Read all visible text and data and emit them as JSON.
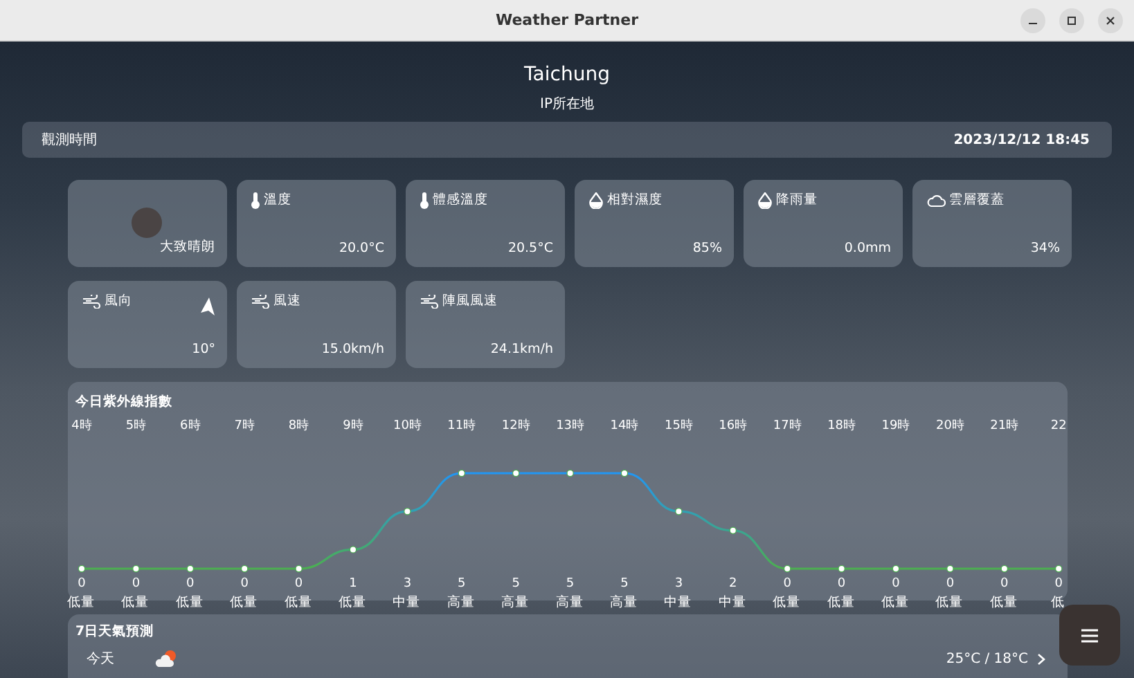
{
  "window": {
    "title": "Weather Partner"
  },
  "location": {
    "city": "Taichung",
    "source": "IP所在地"
  },
  "observation": {
    "label": "觀測時間",
    "time": "2023/12/12 18:45"
  },
  "cards": [
    {
      "kind": "condition",
      "value": "大致晴朗"
    },
    {
      "kind": "thermometer",
      "label": "溫度",
      "value": "20.0°C"
    },
    {
      "kind": "thermometer",
      "label": "體感溫度",
      "value": "20.5°C"
    },
    {
      "kind": "drop",
      "label": "相對濕度",
      "value": "85%"
    },
    {
      "kind": "drop",
      "label": "降雨量",
      "value": "0.0mm"
    },
    {
      "kind": "cloud",
      "label": "雲層覆蓋",
      "value": "34%"
    },
    {
      "kind": "direction",
      "label": "風向",
      "value": "10°"
    },
    {
      "kind": "wind",
      "label": "風速",
      "value": "15.0km/h"
    },
    {
      "kind": "wind",
      "label": "陣風風速",
      "value": "24.1km/h"
    }
  ],
  "uv": {
    "chart_data": {
      "type": "line",
      "title": "今日紫外線指數",
      "categories": [
        "4時",
        "5時",
        "6時",
        "7時",
        "8時",
        "9時",
        "10時",
        "11時",
        "12時",
        "13時",
        "14時",
        "15時",
        "16時",
        "17時",
        "18時",
        "19時",
        "20時",
        "21時",
        "22"
      ],
      "values": [
        0,
        0,
        0,
        0,
        0,
        1,
        3,
        5,
        5,
        5,
        5,
        3,
        2,
        0,
        0,
        0,
        0,
        0,
        0
      ],
      "marker": true,
      "data_labels": true
    },
    "levels": [
      "低量",
      "低量",
      "低量",
      "低量",
      "低量",
      "低量",
      "中量",
      "高量",
      "高量",
      "高量",
      "高量",
      "中量",
      "中量",
      "低量",
      "低量",
      "低量",
      "低量",
      "低量",
      "低"
    ]
  },
  "forecast": {
    "title": "7日天氣預測",
    "days": [
      {
        "day": "今天",
        "temps": "25°C / 18°C"
      }
    ]
  }
}
